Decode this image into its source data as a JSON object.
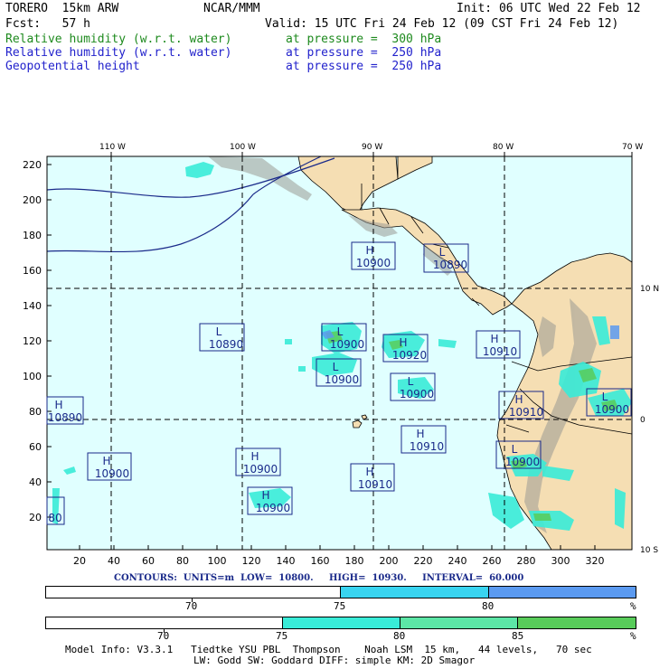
{
  "header": {
    "model": "TORERO  15km ARW",
    "center": "NCAR/MMM",
    "init": "Init: 06 UTC Wed 22 Feb 12",
    "fcst": "Fcst:   57 h",
    "valid": "Valid: 15 UTC Fri 24 Feb 12 (09 CST Fri 24 Feb 12)",
    "fields": [
      {
        "name": "Relative humidity (w.r.t. water)",
        "level": "at pressure =  300 hPa",
        "color": "#1e8a1e"
      },
      {
        "name": "Relative humidity (w.r.t. water)",
        "level": "at pressure =  250 hPa",
        "color": "#2222cc"
      },
      {
        "name": "Geopotential height",
        "level": "at pressure =  250 hPa",
        "color": "#2222cc"
      }
    ]
  },
  "map": {
    "top_lon_labels": [
      "110 W",
      "100 W",
      "90 W",
      "80 W",
      "70 W"
    ],
    "right_lat_labels": [
      "10 N",
      "0",
      "10 S"
    ],
    "y_ticks": [
      "220",
      "200",
      "180",
      "160",
      "140",
      "120",
      "100",
      "80",
      "60",
      "40",
      "20"
    ],
    "x_ticks": [
      "20",
      "40",
      "60",
      "80",
      "100",
      "120",
      "140",
      "160",
      "180",
      "200",
      "220",
      "240",
      "260",
      "280",
      "300",
      "320"
    ],
    "ocean_color": "#e0ffff",
    "land_color": "#f5deb3",
    "contour_color": "#1a2a8a",
    "boxes": [
      {
        "letter": "H",
        "value": "10900"
      },
      {
        "letter": "L",
        "value": "10890"
      },
      {
        "letter": "L",
        "value": "10890"
      },
      {
        "letter": "L",
        "value": "10900"
      },
      {
        "letter": "H",
        "value": "10920"
      },
      {
        "letter": "H",
        "value": "10910"
      },
      {
        "letter": "L",
        "value": "10900"
      },
      {
        "letter": "L",
        "value": "10900"
      },
      {
        "letter": "H",
        "value": "10890"
      },
      {
        "letter": "H",
        "value": "10910"
      },
      {
        "letter": "L",
        "value": "10900"
      },
      {
        "letter": "H",
        "value": "10910"
      },
      {
        "letter": "L",
        "value": "10900"
      },
      {
        "letter": "H",
        "value": "10900"
      },
      {
        "letter": "H",
        "value": "10900"
      },
      {
        "letter": "H",
        "value": "10910"
      },
      {
        "letter": "H",
        "value": "10900"
      },
      {
        "letter": "",
        "value": "80"
      }
    ]
  },
  "contours_line": "CONTOURS:  UNITS=m  LOW=  10800.     HIGH=  10930.     INTERVAL=  60.000",
  "colorbar1": {
    "labels": [
      "70",
      "75",
      "80",
      "%"
    ],
    "colors": [
      "#ffffff",
      "#39d4f0",
      "#5b9af0"
    ]
  },
  "colorbar2": {
    "labels": [
      "70",
      "75",
      "80",
      "85",
      "%"
    ],
    "colors": [
      "#ffffff",
      "#39ecd8",
      "#5ce6a6",
      "#58cc5a"
    ]
  },
  "model_info": [
    "Model Info: V3.3.1   Tiedtke YSU PBL  Thompson    Noah LSM  15 km,   44 levels,   70 sec",
    "LW: Godd SW: Goddard DIFF: simple KM: 2D Smagor"
  ]
}
